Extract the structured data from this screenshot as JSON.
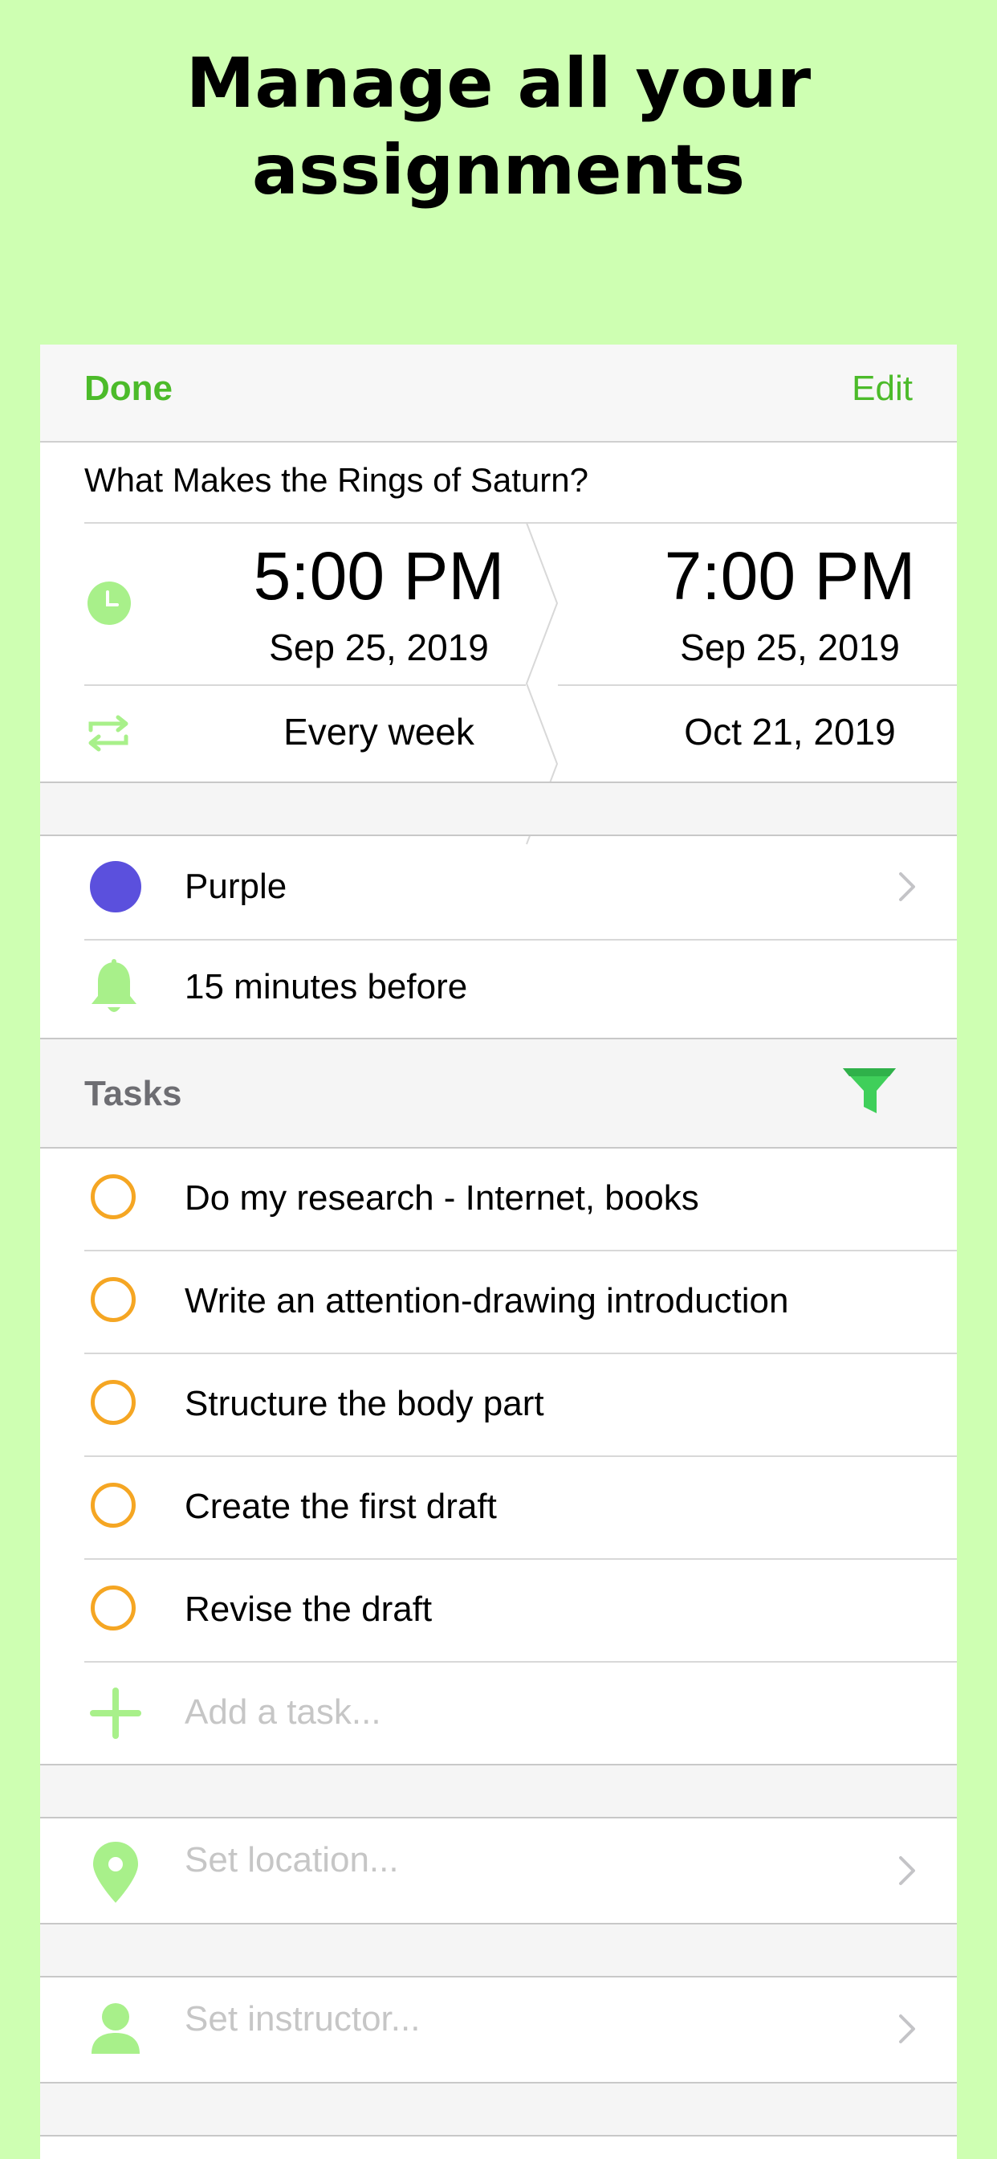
{
  "headline": {
    "line1": "Manage all your",
    "line2": "assignments"
  },
  "nav": {
    "done_label": "Done",
    "edit_label": "Edit"
  },
  "event": {
    "title": "What Makes the Rings of Saturn?",
    "start_time": "5:00 PM",
    "start_date": "Sep 25, 2019",
    "end_time": "7:00 PM",
    "end_date": "Sep 25, 2019",
    "repeat": "Every week",
    "repeat_end": "Oct 21, 2019"
  },
  "color_row": {
    "label": "Purple",
    "swatch": "#5b50dd"
  },
  "alert_row": {
    "label": "15 minutes before"
  },
  "tasks": {
    "header": "Tasks",
    "items": [
      "Do my research - Internet, books",
      "Write an attention-drawing introduction",
      "Structure the body part",
      "Create the first draft",
      "Revise the draft"
    ],
    "add_placeholder": "Add a task..."
  },
  "location_row": {
    "placeholder": "Set location..."
  },
  "instructor_row": {
    "placeholder": "Set instructor..."
  },
  "colors": {
    "background": "#ceffb2",
    "accent_green": "#4cbb2a",
    "icon_green": "#a8f08a",
    "task_circle": "#f5a623",
    "filter_green": "#3fcf5a"
  },
  "icons": [
    "clock-icon",
    "repeat-icon",
    "bell-icon",
    "filter-icon",
    "plus-icon",
    "location-pin-icon",
    "person-icon",
    "chevron-right-icon"
  ]
}
